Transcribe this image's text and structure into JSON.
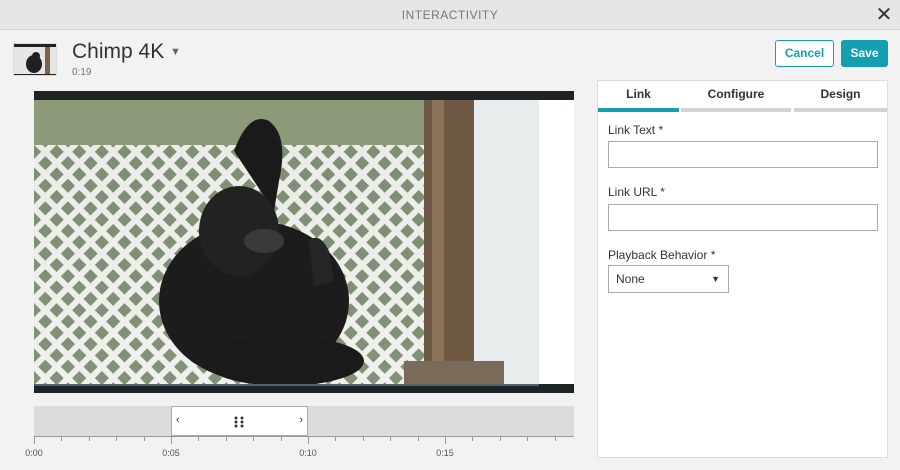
{
  "window": {
    "title": "INTERACTIVITY"
  },
  "video": {
    "title": "Chimp 4K",
    "duration": "0:19"
  },
  "actions": {
    "cancel_label": "Cancel",
    "save_label": "Save"
  },
  "tabs": [
    {
      "label": "Link",
      "active": true
    },
    {
      "label": "Configure",
      "active": false
    },
    {
      "label": "Design",
      "active": false
    }
  ],
  "form": {
    "link_text_label": "Link Text *",
    "link_text_value": "",
    "link_url_label": "Link URL *",
    "link_url_value": "",
    "playback_label": "Playback Behavior *",
    "playback_value": "None"
  },
  "timeline": {
    "labels": [
      "0:00",
      "0:05",
      "0:10",
      "0:15"
    ],
    "selection_start_s": 5,
    "selection_end_s": 10
  },
  "colors": {
    "accent": "#139fb0"
  },
  "icons": [
    "close-icon",
    "chevron-down-icon",
    "chevron-left-icon",
    "chevron-right-icon",
    "drag-handle-icon"
  ]
}
